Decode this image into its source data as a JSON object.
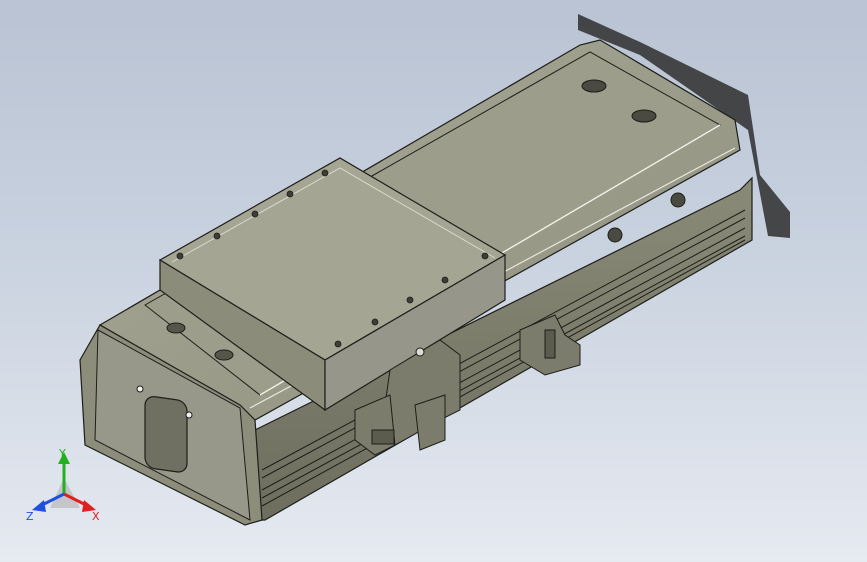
{
  "viewport": {
    "background_top": "#b9c3d3",
    "background_bottom": "#e6eaf1"
  },
  "model": {
    "color_body": "#8c8c7b",
    "color_top": "#a3a392",
    "color_dark": "#5e5e50",
    "edge_color": "#1e1e1a"
  },
  "triad": {
    "x_label": "X",
    "y_label": "Y",
    "z_label": "Z",
    "x_color": "#e02020",
    "y_color": "#20b020",
    "z_color": "#2050e0"
  }
}
